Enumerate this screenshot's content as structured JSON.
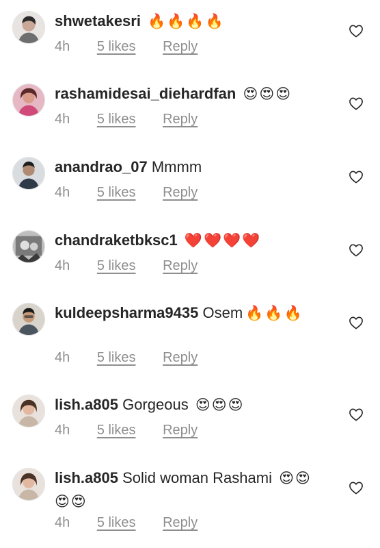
{
  "comments": [
    {
      "username": "shwetakesri",
      "text": "",
      "emoji": "🔥🔥🔥🔥",
      "time": "4h",
      "likes": "5 likes",
      "reply": "Reply"
    },
    {
      "username": "rashamidesai_diehardfan",
      "text": "",
      "emoji": "😍😍😍",
      "time": "4h",
      "likes": "5 likes",
      "reply": "Reply"
    },
    {
      "username": "anandrao_07",
      "text": "Mmmm",
      "emoji": "",
      "time": "4h",
      "likes": "5 likes",
      "reply": "Reply"
    },
    {
      "username": "chandraketbksc1",
      "text": "",
      "emoji": "❤️❤️❤️❤️",
      "time": "4h",
      "likes": "5 likes",
      "reply": "Reply"
    },
    {
      "username": "kuldeepsharma9435",
      "text": "Osem",
      "emoji": "🔥🔥🔥",
      "time": "4h",
      "likes": "5 likes",
      "reply": "Reply"
    },
    {
      "username": "lish.a805",
      "text": "Gorgeous",
      "emoji": "😍😍😍",
      "time": "4h",
      "likes": "5 likes",
      "reply": "Reply"
    },
    {
      "username": "lish.a805",
      "text": "Solid woman Rashami",
      "emoji": "😍😍😍😍",
      "time": "4h",
      "likes": "5 likes",
      "reply": "Reply"
    }
  ],
  "icons": {
    "like": "heart-outline-icon",
    "avatar": "user-avatar"
  },
  "colors": {
    "text": "#262626",
    "meta": "#8e8e8e",
    "fire": "#f4900c",
    "heart_red": "#dd2e44",
    "eyes_face": "#ffcc4d"
  }
}
